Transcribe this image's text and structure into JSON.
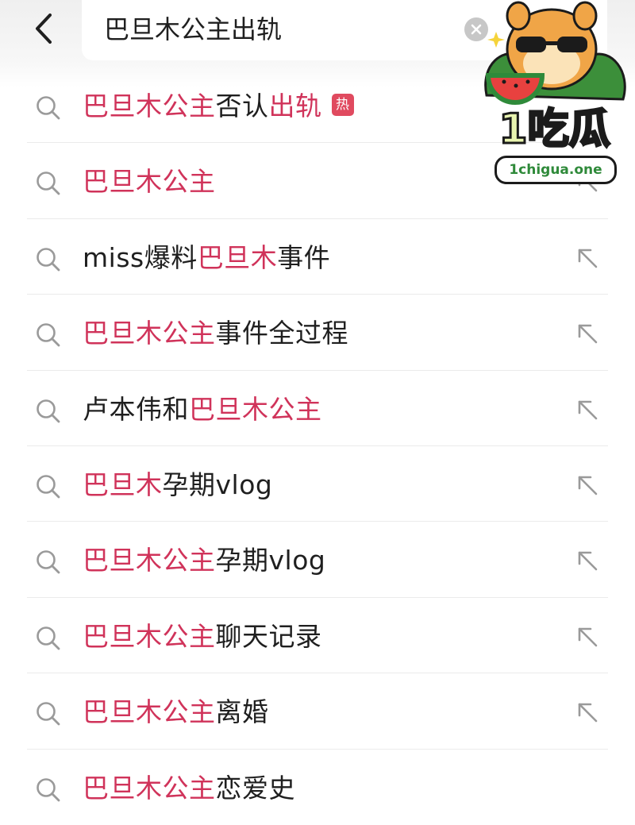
{
  "header": {
    "query": "巴旦木公主出轨"
  },
  "suggestions": [
    {
      "segments": [
        {
          "text": "巴旦木公主",
          "hl": true
        },
        {
          "text": "否认",
          "hl": false
        },
        {
          "text": "出轨",
          "hl": true
        }
      ],
      "badge": "热",
      "show_arrow": false
    },
    {
      "segments": [
        {
          "text": "巴旦木公主",
          "hl": true
        }
      ],
      "badge": null,
      "show_arrow": true
    },
    {
      "segments": [
        {
          "text": "miss爆料",
          "hl": false
        },
        {
          "text": "巴旦木",
          "hl": true
        },
        {
          "text": "事件",
          "hl": false
        }
      ],
      "badge": null,
      "show_arrow": true
    },
    {
      "segments": [
        {
          "text": "巴旦木公主",
          "hl": true
        },
        {
          "text": "事件全过程",
          "hl": false
        }
      ],
      "badge": null,
      "show_arrow": true
    },
    {
      "segments": [
        {
          "text": "卢本伟和",
          "hl": false
        },
        {
          "text": "巴旦木公主",
          "hl": true
        }
      ],
      "badge": null,
      "show_arrow": true
    },
    {
      "segments": [
        {
          "text": "巴旦木",
          "hl": true
        },
        {
          "text": "孕期vlog",
          "hl": false
        }
      ],
      "badge": null,
      "show_arrow": true
    },
    {
      "segments": [
        {
          "text": "巴旦木公主",
          "hl": true
        },
        {
          "text": "孕期vlog",
          "hl": false
        }
      ],
      "badge": null,
      "show_arrow": true
    },
    {
      "segments": [
        {
          "text": "巴旦木公主",
          "hl": true
        },
        {
          "text": "聊天记录",
          "hl": false
        }
      ],
      "badge": null,
      "show_arrow": true
    },
    {
      "segments": [
        {
          "text": "巴旦木公主",
          "hl": true
        },
        {
          "text": "离婚",
          "hl": false
        }
      ],
      "badge": null,
      "show_arrow": true
    },
    {
      "segments": [
        {
          "text": "巴旦木公主",
          "hl": true
        },
        {
          "text": "恋爱史",
          "hl": false
        }
      ],
      "badge": null,
      "show_arrow": false
    }
  ],
  "watermark": {
    "brand": "1吃瓜",
    "url": "1chigua.one"
  },
  "colors": {
    "highlight": "#d0335a",
    "hot_badge": "#e04a5f",
    "text": "#1f1f1f",
    "icon": "#9a9a9a"
  },
  "icons": {
    "back": "chevron-left-icon",
    "clear": "clear-circle-icon",
    "search": "search-icon",
    "fill": "arrow-up-left-icon"
  }
}
